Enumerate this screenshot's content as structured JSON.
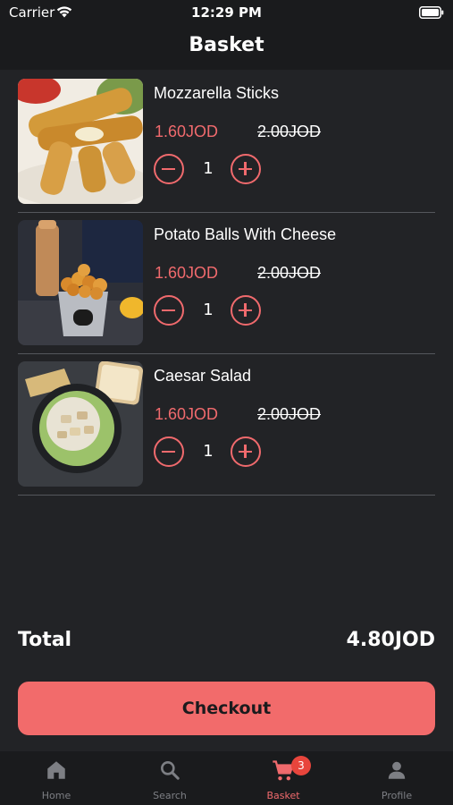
{
  "status_bar": {
    "carrier": "Carrier",
    "time": "12:29 PM"
  },
  "header": {
    "title": "Basket"
  },
  "items": [
    {
      "name": "Mozzarella Sticks",
      "price": "1.60JOD",
      "old_price": "2.00JOD",
      "quantity": "1"
    },
    {
      "name": "Potato Balls With Cheese",
      "price": "1.60JOD",
      "old_price": "2.00JOD",
      "quantity": "1"
    },
    {
      "name": "Caesar Salad",
      "price": "1.60JOD",
      "old_price": "2.00JOD",
      "quantity": "1"
    }
  ],
  "summary": {
    "total_label": "Total",
    "total_value": "4.80JOD"
  },
  "checkout": {
    "label": "Checkout"
  },
  "tabs": [
    {
      "label": "Home",
      "icon": "home-icon"
    },
    {
      "label": "Search",
      "icon": "search-icon"
    },
    {
      "label": "Basket",
      "icon": "cart-icon",
      "badge": "3"
    },
    {
      "label": "Profile",
      "icon": "person-icon"
    }
  ],
  "colors": {
    "accent": "#f06a6d",
    "background": "#222326",
    "bar": "#1a1b1d",
    "badge": "#e8453c"
  }
}
